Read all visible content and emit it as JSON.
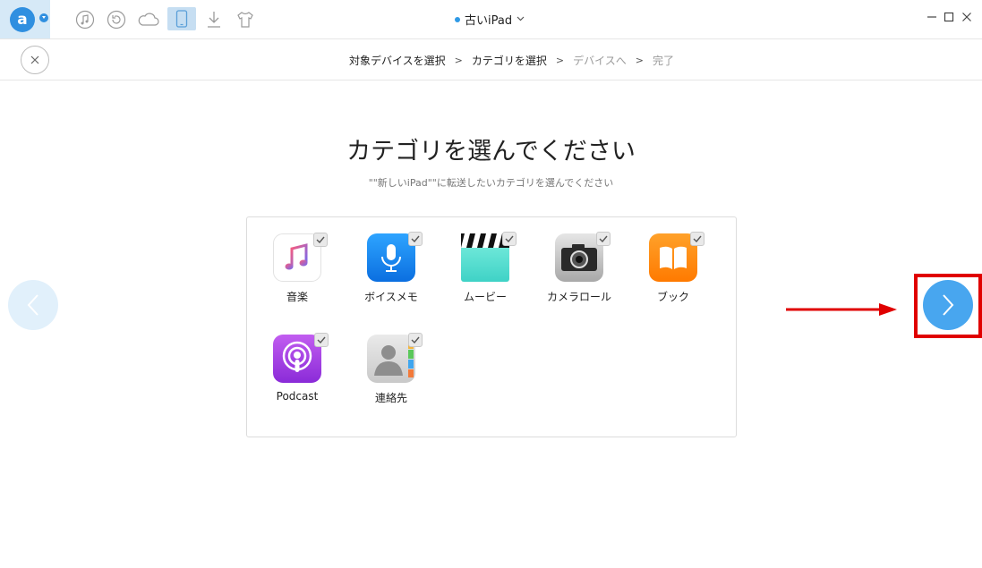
{
  "app": {
    "logo_letter": "a",
    "device_name": "古いiPad",
    "device_dot_color": "#2f9ae6",
    "toolbar_icons": [
      "music-icon",
      "restore-icon",
      "cloud-icon",
      "device-icon",
      "download-icon",
      "tshirt-icon"
    ],
    "active_toolbar_icon": "device-icon",
    "window_controls": [
      "minimize-icon",
      "maximize-icon",
      "close-icon"
    ]
  },
  "steps": {
    "items": [
      {
        "label": "対象デバイスを選択",
        "state": "done"
      },
      {
        "label": "カテゴリを選択",
        "state": "done"
      },
      {
        "label": "デバイスへ",
        "state": "todo"
      },
      {
        "label": "完了",
        "state": "todo"
      }
    ],
    "separator": ">"
  },
  "main": {
    "title": "カテゴリを選んでください",
    "subtitle": "\"\"新しいiPad\"\"に転送したいカテゴリを選んでください"
  },
  "categories": [
    {
      "label": "音楽",
      "icon": "music-app-icon",
      "checked": true
    },
    {
      "label": "ボイスメモ",
      "icon": "voice-memo-icon",
      "checked": true
    },
    {
      "label": "ムービー",
      "icon": "movie-icon",
      "checked": true
    },
    {
      "label": "カメラロール",
      "icon": "camera-icon",
      "checked": true
    },
    {
      "label": "ブック",
      "icon": "books-icon",
      "checked": true
    },
    {
      "label": "Podcast",
      "icon": "podcast-icon",
      "checked": true
    },
    {
      "label": "連絡先",
      "icon": "contacts-icon",
      "checked": true
    }
  ],
  "colors": {
    "accent": "#48a6ef",
    "highlight": "#e00000"
  }
}
